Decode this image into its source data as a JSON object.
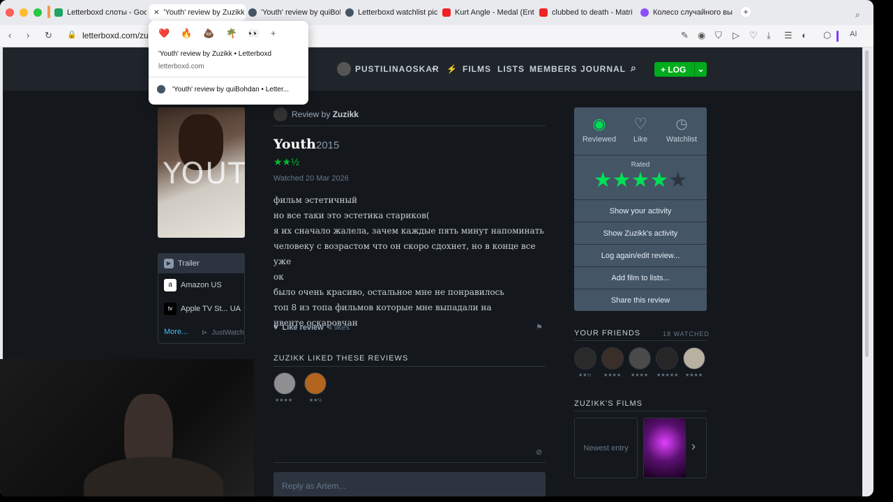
{
  "browser": {
    "tabs": [
      {
        "label": "Letterboxd слоты - Goo",
        "color": "#1ea362"
      },
      {
        "label": "'Youth' review by Zuzikk",
        "color": "#777"
      },
      {
        "label": "'Youth' review by quiBoh",
        "color": "#445566"
      },
      {
        "label": "Letterboxd watchlist pic",
        "color": "#445566"
      },
      {
        "label": "Kurt Angle - Medal (Ent",
        "color": "#e22"
      },
      {
        "label": "clubbed to death - Matri",
        "color": "#e22"
      },
      {
        "label": "Колесо случайного выб",
        "color": "#8a4fff"
      }
    ],
    "new_tab_label": "+",
    "url": "letterboxd.com/zu",
    "ai_label": "AI"
  },
  "popup": {
    "emojis": [
      "❤️",
      "🔥",
      "💩",
      "🌴",
      "👀",
      "+"
    ],
    "title": "'Youth' review by Zuzikk • Letterboxd",
    "domain": "letterboxd.com",
    "other": "'Youth' review by quiBohdan • Letter..."
  },
  "site": {
    "username": "PUSTILINAOSKAR",
    "nav": [
      "FILMS",
      "LISTS",
      "MEMBERS",
      "JOURNAL"
    ],
    "log_label": "+ LOG"
  },
  "poster": {
    "text": "YOUTH"
  },
  "watch": {
    "trailer": "Trailer",
    "services": [
      "Amazon US",
      "Apple TV St...  UA"
    ],
    "more": "More...",
    "justwatch": "JustWatch"
  },
  "review": {
    "byline_prefix": "Review by",
    "author": "Zuzikk",
    "film_title": "Youth",
    "year": "2015",
    "rating_stars": "★★½",
    "watched": "Watched 20 Mar 2026",
    "lines": [
      "фильм эстетичный",
      "но все таки это эстетика стариков(",
      "я их сначало жалела, зачем каждые пять минут напоминать",
      "человеку с возрастом что он скоро сдохнет, но в конце все уже",
      "ок",
      "было очень красиво, остальное мне не понравилось",
      "топ 8 из топа фильмов которые мне выпадали на",
      "ивенте оскаровчан"
    ],
    "like_label": "Like review",
    "likes": "4 likes",
    "liked_title": "ZUZIKK LIKED THESE REVIEWS",
    "liked_ratings": [
      "★★★★",
      "★★½"
    ],
    "reply_placeholder": "Reply as Artem..."
  },
  "panel": {
    "reviewed": "Reviewed",
    "like": "Like",
    "watchlist": "Watchlist",
    "rated": "Rated",
    "rating_value": 4,
    "rating_max": 5,
    "buttons": [
      "Show your activity",
      "Show Zuzikk's activity",
      "Log again/edit review...",
      "Add film to lists...",
      "Share this review"
    ],
    "friends_title": "YOUR FRIENDS",
    "watched_count": "18 WATCHED",
    "friend_ratings": [
      "★★½",
      "★★★★",
      "★★★★",
      "★★★★★",
      "★★★★"
    ],
    "films_title": "ZUZIKK'S FILMS",
    "newest": "Newest entry"
  },
  "colors": {
    "accent": "#00e054",
    "bg": "#14181c",
    "panel": "#445566"
  }
}
